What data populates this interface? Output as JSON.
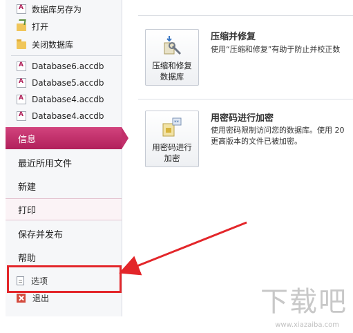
{
  "recent_files": [
    {
      "label": "数据库另存为",
      "icon": "database-save-as-icon"
    },
    {
      "label": "打开",
      "icon": "open-folder-icon"
    },
    {
      "label": "关闭数据库",
      "icon": "close-database-folder-icon"
    },
    {
      "label": "Database6.accdb",
      "icon": "access-file-icon"
    },
    {
      "label": "Database5.accdb",
      "icon": "access-file-icon"
    },
    {
      "label": "Database4.accdb",
      "icon": "access-file-icon"
    },
    {
      "label": "Database4.accdb",
      "icon": "access-file-icon"
    }
  ],
  "nav": {
    "info": "信息",
    "recent": "最近所用文件",
    "new": "新建",
    "print": "打印",
    "save_publish": "保存并发布",
    "help": "帮助",
    "options": "选项",
    "exit": "退出"
  },
  "compact": {
    "button_label": "压缩和修复\n数据库",
    "title": "压缩并修复",
    "desc": "使用“压缩和修复”有助于防止并校正数"
  },
  "encrypt": {
    "button_label": "用密码进行\n加密",
    "title": "用密码进行加密",
    "desc_line1": "使用密码限制访问您的数据库。使用 20",
    "desc_line2": "更高版本的文件已被加密。"
  },
  "watermark": {
    "text": "下载吧",
    "url": "www.xiazaiba.com"
  },
  "colors": {
    "accent": "#c2306b",
    "highlight": "#e3262a"
  }
}
